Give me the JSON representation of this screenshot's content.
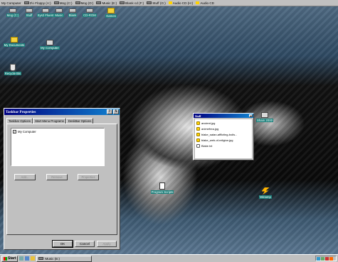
{
  "drive_bar": [
    {
      "label": "My Computer",
      "icon": "computer-icon"
    },
    {
      "label": "3½ Floppy (A:)",
      "icon": "floppy-icon"
    },
    {
      "label": "Mog (C:)",
      "icon": "hard-drive-icon"
    },
    {
      "label": "Mog (D:)",
      "icon": "hard-drive-icon"
    },
    {
      "label": "Music (E:)",
      "icon": "hard-drive-icon"
    },
    {
      "label": "Blank cd (F:)",
      "icon": "cd-drive-icon"
    },
    {
      "label": "Stuff (G:)",
      "icon": "hard-drive-icon"
    },
    {
      "label": "Audio CD (H:)",
      "icon": "audio-cd-icon"
    },
    {
      "label": "Audio CD",
      "icon": "audio-cd-icon"
    }
  ],
  "desktop_icons": {
    "top_row": [
      "Mog (C:)",
      "Stuff",
      "Sys2 Fluent",
      "Music",
      "Blank",
      "CD-ROM",
      "Games"
    ],
    "my_documents": "My Documents",
    "my_computer": "My Computer",
    "recycle_bin": "Recycle Bin",
    "bottom_doc": "Program Scripts",
    "winamp": "Winamp",
    "right_icon": "Sham 2000"
  },
  "taskbar_properties": {
    "title": "Taskbar Properties",
    "help_btn": "?",
    "close_btn": "X",
    "tabs": [
      "Taskbar Options",
      "Start Menu Programs",
      "DeskBar Options"
    ],
    "active_tab": 2,
    "list_items": [
      {
        "label": "My Computer",
        "checked": true
      }
    ],
    "panel_buttons": [
      "Add...",
      "Remove",
      "Properties"
    ],
    "ok": "OK",
    "cancel": "Cancel",
    "apply": "Apply"
  },
  "file_window": {
    "title": "Stuff",
    "files": [
      {
        "name": "ancient.jpg",
        "icon": "image-file-icon"
      },
      {
        "name": "animefrea.jpg",
        "icon": "image-file-icon"
      },
      {
        "name": "blake_satan-afflicting-boils...",
        "icon": "image-file-icon"
      },
      {
        "name": "blake_web-of-religion.jpg",
        "icon": "image-file-icon"
      },
      {
        "name": "Blake.txt",
        "icon": "text-file-icon"
      }
    ]
  },
  "taskbar": {
    "start_label": "Start",
    "tasks": [
      "Music (E:)"
    ]
  },
  "colors": {
    "title_active": "#000080",
    "desktop_label_bg": "#1a7f7a",
    "window_face": "#c0c0c0"
  }
}
